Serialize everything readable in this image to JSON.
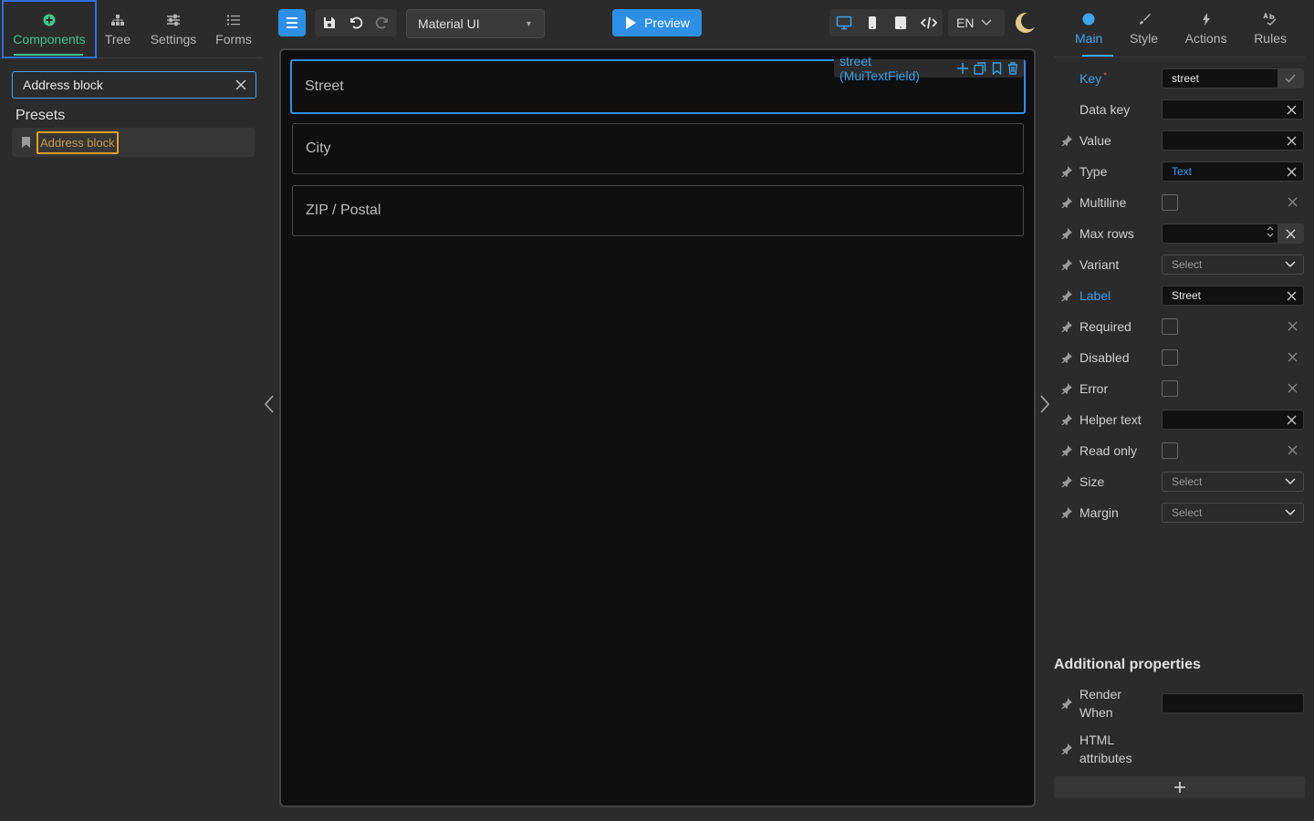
{
  "left_tabs": [
    {
      "label": "Components",
      "icon": "plus-circle-icon"
    },
    {
      "label": "Tree",
      "icon": "tree-icon"
    },
    {
      "label": "Settings",
      "icon": "sliders-icon"
    },
    {
      "label": "Forms",
      "icon": "list-icon"
    }
  ],
  "search": {
    "value": "Address block"
  },
  "presets": {
    "title": "Presets",
    "items": [
      {
        "label": "Address block"
      }
    ]
  },
  "toolbar": {
    "library": "Material UI",
    "preview_label": "Preview",
    "language": "EN"
  },
  "canvas": {
    "selected_tag": "street (MuiTextField)",
    "fields": [
      {
        "label": "Street"
      },
      {
        "label": "City"
      },
      {
        "label": "ZIP / Postal"
      }
    ]
  },
  "right_tabs": [
    {
      "label": "Main",
      "icon": "dot-icon"
    },
    {
      "label": "Style",
      "icon": "brush-icon"
    },
    {
      "label": "Actions",
      "icon": "bolt-icon"
    },
    {
      "label": "Rules",
      "icon": "rules-icon"
    }
  ],
  "props": {
    "key": {
      "label": "Key",
      "value": "street"
    },
    "data_key": {
      "label": "Data key",
      "value": ""
    },
    "value": {
      "label": "Value",
      "value": ""
    },
    "type": {
      "label": "Type",
      "value": "Text"
    },
    "multiline": {
      "label": "Multiline"
    },
    "max_rows": {
      "label": "Max rows",
      "value": ""
    },
    "variant": {
      "label": "Variant",
      "value": "Select"
    },
    "label": {
      "label": "Label",
      "value": "Street"
    },
    "required": {
      "label": "Required"
    },
    "disabled": {
      "label": "Disabled"
    },
    "error": {
      "label": "Error"
    },
    "helper_text": {
      "label": "Helper text",
      "value": ""
    },
    "read_only": {
      "label": "Read only"
    },
    "size": {
      "label": "Size",
      "value": "Select"
    },
    "margin": {
      "label": "Margin",
      "value": "Select"
    }
  },
  "additional": {
    "title": "Additional properties",
    "render_when": {
      "label1": "Render",
      "label2": "When"
    },
    "html_attributes": {
      "label1": "HTML",
      "label2": "attributes"
    }
  },
  "colors": {
    "accent_blue": "#2d8fe6",
    "accent_green": "#3fc48f",
    "highlight_orange": "#f0a01e"
  }
}
